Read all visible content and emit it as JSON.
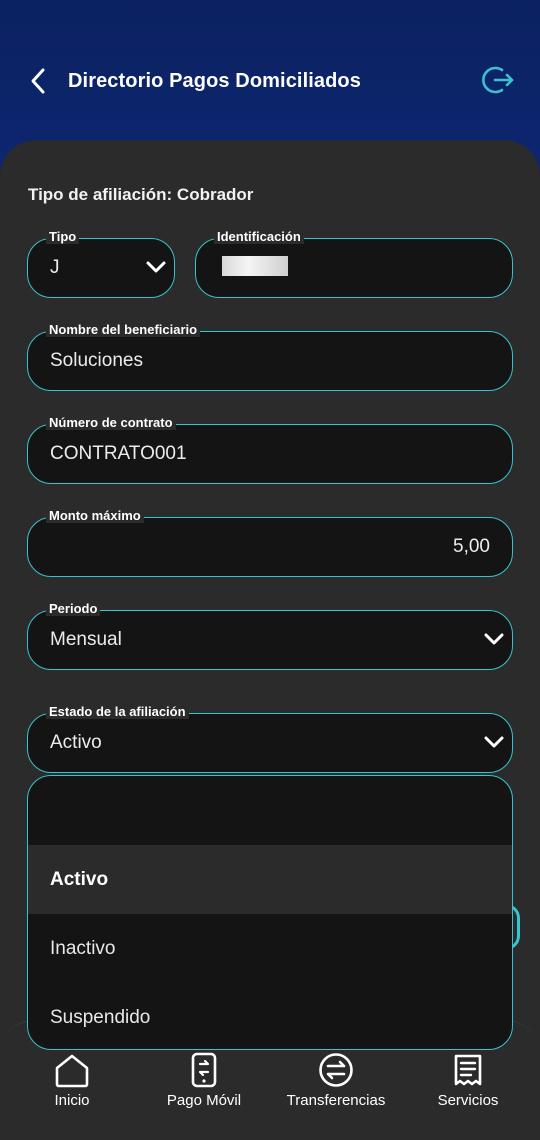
{
  "header": {
    "title": "Directorio Pagos Domiciliados",
    "back_icon": "chevron-left-icon",
    "logout_icon": "logout-icon",
    "accent_color": "#39c2cf"
  },
  "form": {
    "section_title": "Tipo de afiliación: Cobrador",
    "tipo": {
      "label": "Tipo",
      "value": "J"
    },
    "identificacion": {
      "label": "Identificación",
      "value": ""
    },
    "nombre": {
      "label": "Nombre del beneficiario",
      "value": "Soluciones"
    },
    "contrato": {
      "label": "Número de contrato",
      "value": "CONTRATO001"
    },
    "monto": {
      "label": "Monto máximo",
      "value": "5,00"
    },
    "periodo": {
      "label": "Periodo",
      "value": "Mensual"
    },
    "estado": {
      "label": "Estado de la afiliación",
      "value": "Activo"
    }
  },
  "dropdown": {
    "options": [
      "",
      "Activo",
      "Inactivo",
      "Suspendido"
    ],
    "selected": "Activo"
  },
  "bottom_nav": {
    "items": [
      {
        "label": "Inicio",
        "icon": "home-icon"
      },
      {
        "label": "Pago Móvil",
        "icon": "mobile-payment-icon"
      },
      {
        "label": "Transferencias",
        "icon": "transfer-icon"
      },
      {
        "label": "Servicios",
        "icon": "receipt-icon"
      }
    ]
  }
}
